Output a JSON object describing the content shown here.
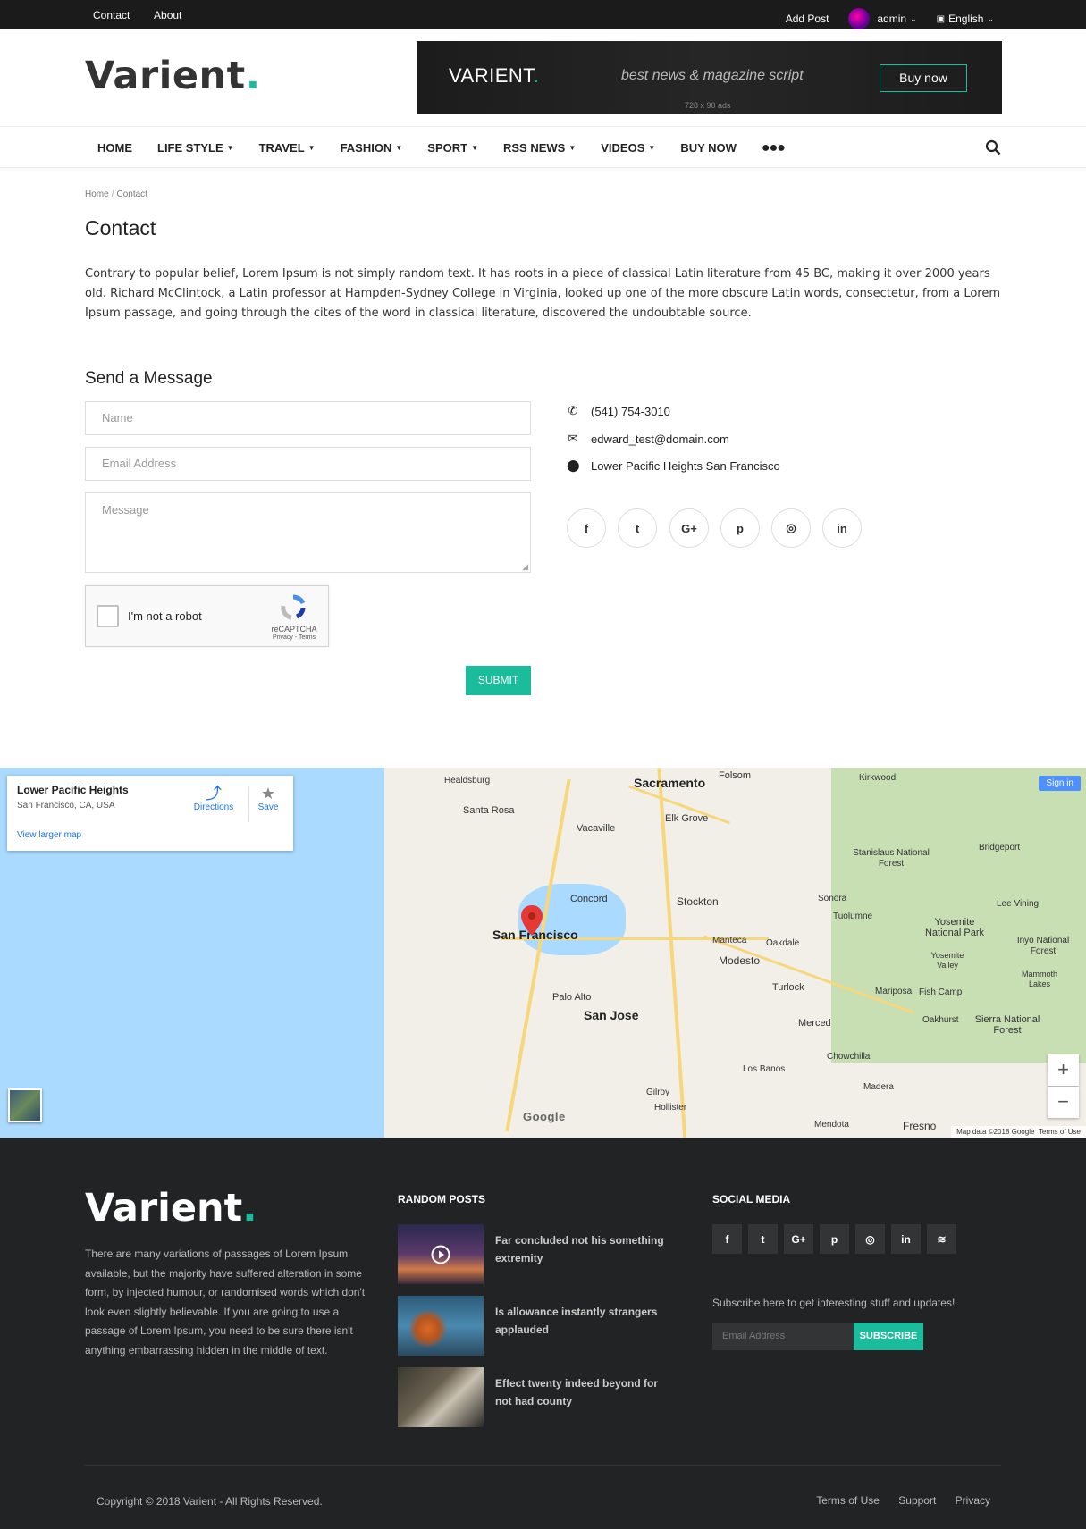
{
  "topbar": {
    "links": [
      "Contact",
      "About"
    ],
    "add_post": "Add Post",
    "user": "admin",
    "language": "English"
  },
  "brand": {
    "name": "Varient",
    "dot": "."
  },
  "banner": {
    "logo": "VARIENT",
    "dot": ".",
    "tagline": "best news & magazine script",
    "cta": "Buy now",
    "size_note": "728 x 90 ads"
  },
  "nav": {
    "items": [
      {
        "label": "HOME",
        "dropdown": false
      },
      {
        "label": "LIFE STYLE",
        "dropdown": true
      },
      {
        "label": "TRAVEL",
        "dropdown": true
      },
      {
        "label": "FASHION",
        "dropdown": true
      },
      {
        "label": "SPORT",
        "dropdown": true
      },
      {
        "label": "RSS NEWS",
        "dropdown": true
      },
      {
        "label": "VIDEOS",
        "dropdown": true
      },
      {
        "label": "BUY NOW",
        "dropdown": false
      }
    ],
    "more_icon": "ellipsis-icon",
    "search_icon": "search-icon"
  },
  "breadcrumb": {
    "home": "Home",
    "separator": "/",
    "current": "Contact"
  },
  "page": {
    "title": "Contact",
    "text": "Contrary to popular belief, Lorem Ipsum is not simply random text. It has roots in a piece of classical Latin literature from 45 BC, making it over 2000 years old. Richard McClintock, a Latin professor at Hampden-Sydney College in Virginia, looked up one of the more obscure Latin words, consectetur, from a Lorem Ipsum passage, and going through the cites of the word in classical literature, discovered the undoubtable source."
  },
  "form": {
    "heading": "Send a Message",
    "name_placeholder": "Name",
    "email_placeholder": "Email Address",
    "message_placeholder": "Message",
    "captcha_label": "I'm not a robot",
    "captcha_brand": "reCAPTCHA",
    "captcha_links": "Privacy - Terms",
    "submit": "SUBMIT"
  },
  "contact": {
    "phone": "(541) 754-3010",
    "email": "edward_test@domain.com",
    "address": "Lower Pacific Heights San Francisco",
    "social": [
      {
        "icon": "facebook-icon",
        "glyph": "f"
      },
      {
        "icon": "twitter-icon",
        "glyph": "t"
      },
      {
        "icon": "google-plus-icon",
        "glyph": "G+"
      },
      {
        "icon": "pinterest-icon",
        "glyph": "p"
      },
      {
        "icon": "instagram-icon",
        "glyph": "◎"
      },
      {
        "icon": "linkedin-icon",
        "glyph": "in"
      }
    ]
  },
  "map": {
    "place": "Lower Pacific Heights",
    "place_sub": "San Francisco, CA, USA",
    "directions": "Directions",
    "save": "Save",
    "larger": "View larger map",
    "sign_in": "Sign in",
    "attribution": "Map data ©2018 Google",
    "terms": "Terms of Use",
    "google": "Google",
    "zoom_in": "+",
    "zoom_out": "−",
    "cities": {
      "sacramento": "Sacramento",
      "folsom": "Folsom",
      "healdsburg": "Healdsburg",
      "kirkwood": "Kirkwood",
      "santa_rosa": "Santa Rosa",
      "vacaville": "Vacaville",
      "elk_grove": "Elk Grove",
      "stanislaus": "Stanislaus National Forest",
      "bridgeport": "Bridgeport",
      "concord": "Concord",
      "stockton": "Stockton",
      "sonora": "Sonora",
      "tuolumne": "Tuolumne",
      "lee_vining": "Lee Vining",
      "san_francisco": "San Francisco",
      "manteca": "Manteca",
      "oakdale": "Oakdale",
      "yosemite_np": "Yosemite National Park",
      "yosemite_valley": "Yosemite Valley",
      "inyo": "Inyo National Forest",
      "modesto": "Modesto",
      "mammoth": "Mammoth Lakes",
      "palo_alto": "Palo Alto",
      "turlock": "Turlock",
      "mariposa": "Mariposa",
      "fish_camp": "Fish Camp",
      "san_jose": "San Jose",
      "merced": "Merced",
      "oakhurst": "Oakhurst",
      "sierra": "Sierra National Forest",
      "chowchilla": "Chowchilla",
      "los_banos": "Los Banos",
      "gilroy": "Gilroy",
      "madera": "Madera",
      "hollister": "Hollister",
      "mendota": "Mendota",
      "fresno": "Fresno"
    }
  },
  "footer": {
    "about": "There are many variations of passages of Lorem Ipsum available, but the majority have suffered alteration in some form, by injected humour, or randomised words which don't look even slightly believable. If you are going to use a passage of Lorem Ipsum, you need to be sure there isn't anything embarrassing hidden in the middle of text.",
    "random_heading": "RANDOM POSTS",
    "posts": [
      {
        "title": "Far concluded not his something extremity"
      },
      {
        "title": "Is allowance instantly strangers applauded"
      },
      {
        "title": "Effect twenty indeed beyond for not had county"
      }
    ],
    "social_heading": "SOCIAL MEDIA",
    "social": [
      {
        "icon": "facebook-icon",
        "glyph": "f"
      },
      {
        "icon": "twitter-icon",
        "glyph": "t"
      },
      {
        "icon": "google-plus-icon",
        "glyph": "G+"
      },
      {
        "icon": "pinterest-icon",
        "glyph": "p"
      },
      {
        "icon": "instagram-icon",
        "glyph": "◎"
      },
      {
        "icon": "linkedin-icon",
        "glyph": "in"
      },
      {
        "icon": "rss-icon",
        "glyph": "≋"
      }
    ],
    "subscribe_text": "Subscribe here to get interesting stuff and updates!",
    "subscribe_placeholder": "Email Address",
    "subscribe_button": "SUBSCRIBE",
    "copyright": "Copyright © 2018 Varient - All Rights Reserved.",
    "links": [
      "Terms of Use",
      "Support",
      "Privacy"
    ]
  },
  "colors": {
    "accent": "#1abc9c",
    "dark": "#222324",
    "topbar": "#1b1b1b"
  }
}
